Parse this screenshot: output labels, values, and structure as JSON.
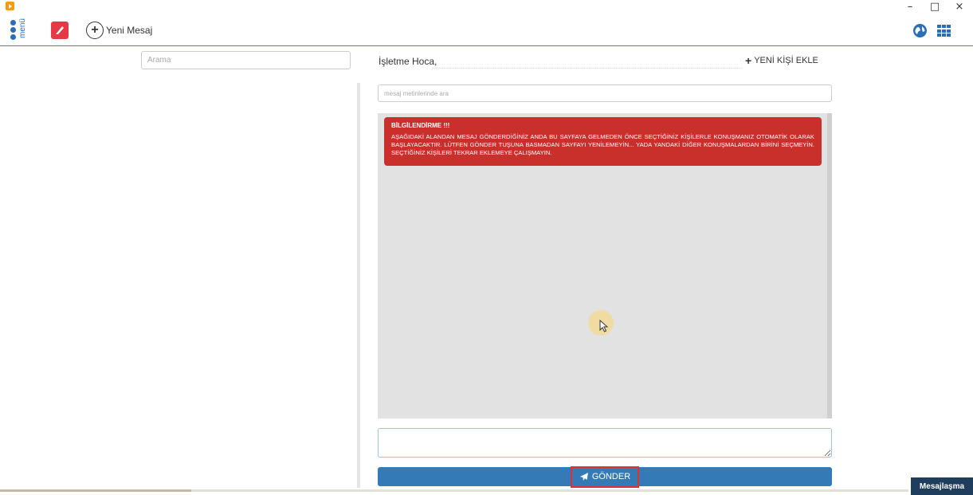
{
  "window": {
    "minimize": "–",
    "maximize": "□",
    "close": "×"
  },
  "toolbar": {
    "menu_label": "menü",
    "new_message_label": "Yeni Mesaj",
    "icons": [
      "menu-icon",
      "app-logo-icon",
      "plus-circle-icon",
      "globe-icon",
      "apps-grid-icon"
    ]
  },
  "sidebar": {
    "search_placeholder": "Arama"
  },
  "conversation": {
    "recipient": "İşletme Hoca,",
    "add_person_label": "YENİ KİŞİ EKLE",
    "search_placeholder": "mesaj metinlerinde ara"
  },
  "alert": {
    "title": "BİLGİLENDİRME !!!",
    "body": "AŞAĞIDAKİ ALANDAN MESAJ GÖNDERDİĞİNİZ ANDA BU SAYFAYA GELMEDEN ÖNCE SEÇTİĞİNİZ KİŞİLERLE KONUŞMANIZ OTOMATİK OLARAK BAŞLAYACAKTIR. LÜTFEN GÖNDER TUŞUNA BASMADAN SAYFAYI YENİLEMEYİN... YADA YANDAKİ DİĞER KONUŞMALARDAN BİRİNİ SEÇMEYİN. SEÇTİĞİNİZ KİŞİLERİ TEKRAR EKLEMEYE ÇALIŞMAYIN.",
    "color": "#c9302c"
  },
  "composer": {
    "value": "",
    "send_label": "GÖNDER"
  },
  "footer": {
    "tag": "Mesajlaşma"
  },
  "colors": {
    "primary": "#337ab7",
    "accent": "#2a6fb5",
    "logo": "#e63946"
  }
}
